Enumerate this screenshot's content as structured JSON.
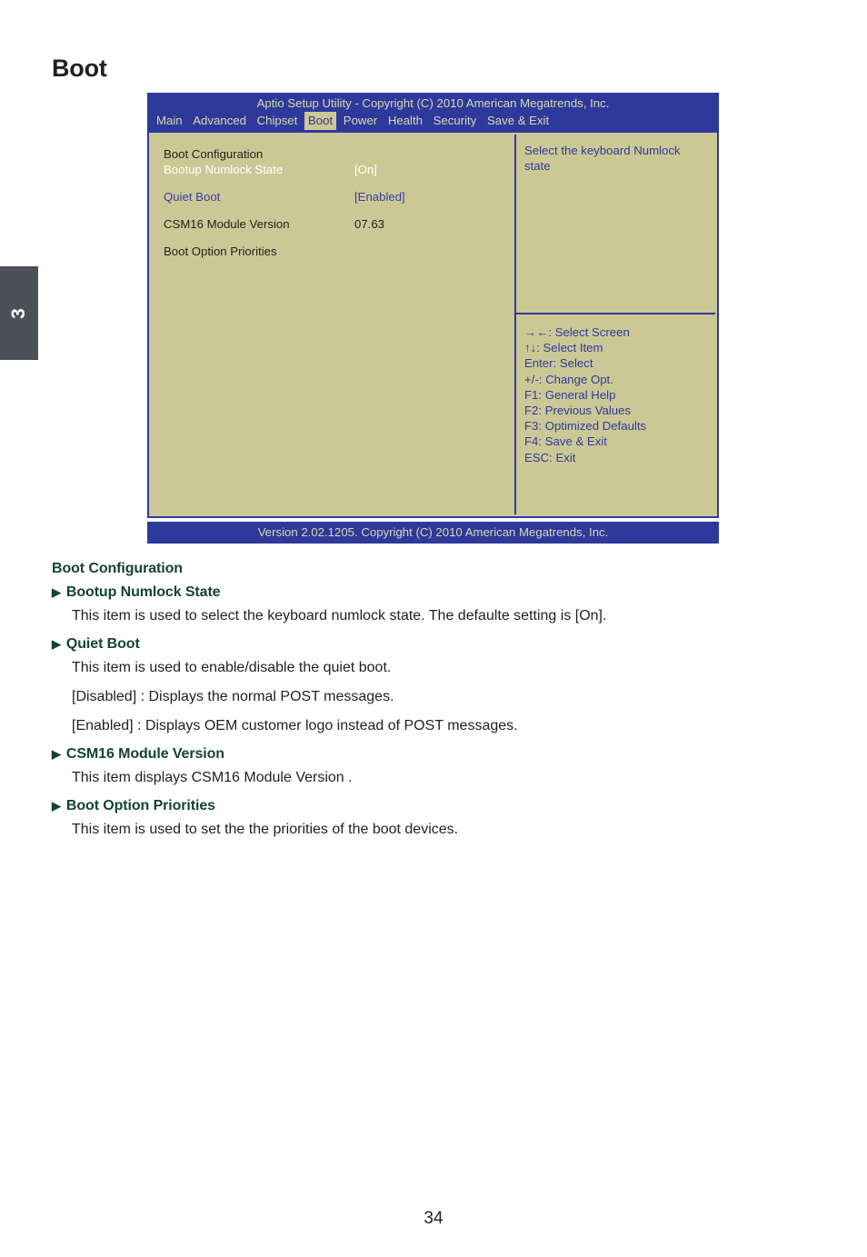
{
  "page": {
    "title": "Boot",
    "chapter_tab": "3",
    "page_number": "34"
  },
  "bios": {
    "header_title": "Aptio Setup Utility - Copyright (C) 2010 American Megatrends, Inc.",
    "tabs": [
      {
        "label": "Main",
        "active": false
      },
      {
        "label": "Advanced",
        "active": false
      },
      {
        "label": "Chipset",
        "active": false
      },
      {
        "label": "Boot",
        "active": true
      },
      {
        "label": "Power",
        "active": false
      },
      {
        "label": "Health",
        "active": false
      },
      {
        "label": "Security",
        "active": false
      },
      {
        "label": "Save & Exit",
        "active": false
      }
    ],
    "section_title": "Boot Configuration",
    "options": [
      {
        "label": "Bootup Numlock State",
        "value": "[On]",
        "style": "sel"
      },
      {
        "label": "Quiet Boot",
        "value": "[Enabled]",
        "style": "link"
      },
      {
        "label": "CSM16 Module Version",
        "value": "07.63",
        "style": "plain"
      },
      {
        "label": "Boot Option Priorities",
        "value": "",
        "style": "plain"
      }
    ],
    "help_text": "Select the keyboard Numlock state",
    "keys": [
      "→←: Select Screen",
      "↑↓: Select Item",
      "Enter: Select",
      "+/-: Change Opt.",
      "F1:  General Help",
      "F2:  Previous Values",
      "F3: Optimized Defaults",
      "F4: Save & Exit",
      "ESC: Exit"
    ],
    "footer": "Version 2.02.1205. Copyright (C) 2010 American Megatrends, Inc."
  },
  "prose": {
    "section_heading": "Boot Configuration",
    "items": [
      {
        "heading": "Bootup Numlock State",
        "lines": [
          "This item is used to select the keyboard numlock state. The defaulte setting is [On]."
        ]
      },
      {
        "heading": "Quiet Boot",
        "lines": [
          "This item is used to enable/disable the quiet boot.",
          "[Disabled] : Displays the normal POST messages.",
          "[Enabled] : Displays OEM customer logo instead of POST messages."
        ]
      },
      {
        "heading": "CSM16 Module Version",
        "lines": [
          "This item displays CSM16 Module Version ."
        ]
      },
      {
        "heading": "Boot Option Priorities",
        "lines": [
          "This item is used to set the the priorities of the boot devices."
        ]
      }
    ],
    "bullet_glyph": "▶"
  }
}
